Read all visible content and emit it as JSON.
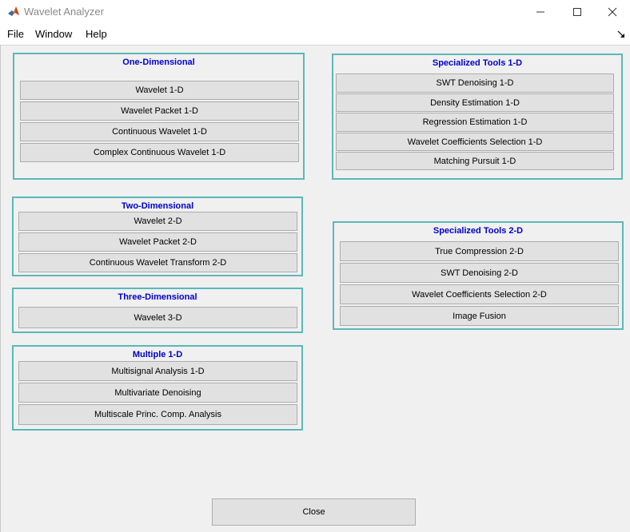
{
  "window": {
    "title": "Wavelet Analyzer",
    "icon": "matlab-icon",
    "controls": [
      "minimize-icon",
      "maximize-icon",
      "close-icon"
    ]
  },
  "menu": {
    "items": [
      {
        "label": "File"
      },
      {
        "label": "Window"
      },
      {
        "label": "Help"
      }
    ]
  },
  "panels": {
    "one_d": {
      "title": "One-Dimensional",
      "buttons": [
        "Wavelet 1-D",
        "Wavelet Packet 1-D",
        "Continuous Wavelet 1-D",
        "Complex Continuous Wavelet 1-D"
      ]
    },
    "two_d": {
      "title": "Two-Dimensional",
      "buttons": [
        "Wavelet 2-D",
        "Wavelet Packet 2-D",
        "Continuous Wavelet Transform 2-D"
      ]
    },
    "three_d": {
      "title": "Three-Dimensional",
      "buttons": [
        "Wavelet 3-D"
      ]
    },
    "multiple_1d": {
      "title": "Multiple 1-D",
      "buttons": [
        "Multisignal Analysis 1-D",
        "Multivariate Denoising",
        "Multiscale Princ. Comp. Analysis"
      ]
    },
    "spec_1d": {
      "title": "Specialized Tools 1-D",
      "buttons": [
        "SWT Denoising 1-D",
        "Density Estimation 1-D",
        "Regression Estimation 1-D",
        "Wavelet Coefficients Selection 1-D",
        "Matching Pursuit 1-D"
      ]
    },
    "spec_2d": {
      "title": "Specialized Tools 2-D",
      "buttons": [
        "True Compression 2-D",
        "SWT Denoising 2-D",
        "Wavelet Coefficients Selection 2-D",
        "Image Fusion"
      ]
    }
  },
  "close_button": {
    "label": "Close"
  },
  "colors": {
    "panel_border": "#5bb8b8",
    "panel_title": "#0000cc",
    "button_face": "#e1e1e1",
    "background": "#f0f0f0"
  }
}
